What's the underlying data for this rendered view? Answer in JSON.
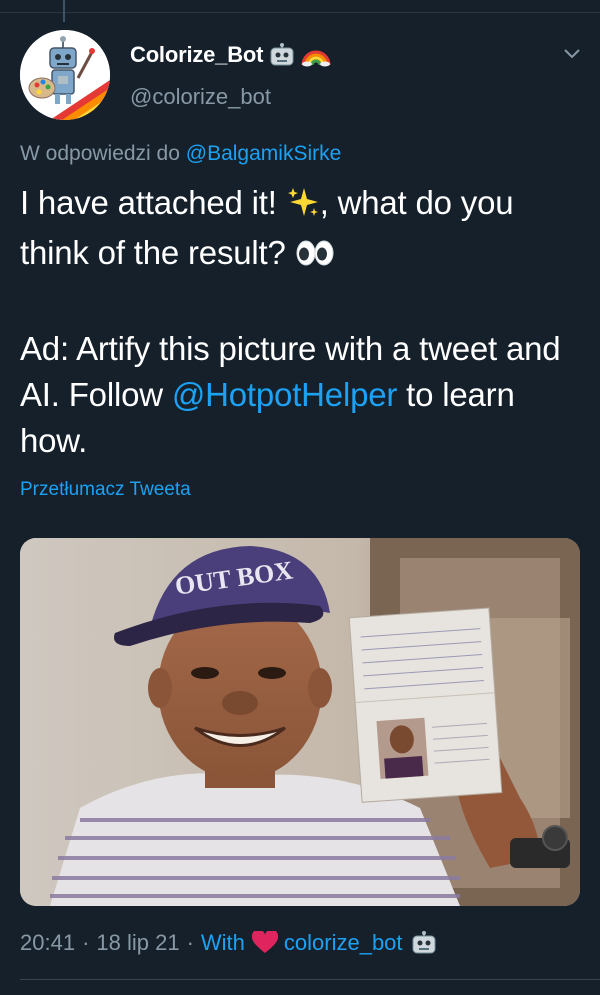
{
  "tweet": {
    "display_name": "Colorize_Bot",
    "handle": "@colorize_bot",
    "name_icons": [
      "robot-icon",
      "rainbow-icon"
    ],
    "reply_prefix": "W odpowiedzi do",
    "reply_mention": "@BalgamikSirke",
    "line1_before": "I have attached it!",
    "line1_after": ", what do you think of the result?",
    "ad_before": "Ad: Artify this picture with a tweet and AI. Follow",
    "ad_link": "@HotpotHelper",
    "ad_after": " to learn how.",
    "translate_label": "Przetłumacz Tweeta",
    "media_text": "OUT BOX",
    "time": "20:41",
    "date": "18 lip 21",
    "via_label": "With",
    "app_name": "colorize_bot"
  },
  "colors": {
    "background": "#15202b",
    "text": "#ffffff",
    "secondary": "#8899a6",
    "link": "#1da1f2",
    "heart": "#e0245e"
  }
}
